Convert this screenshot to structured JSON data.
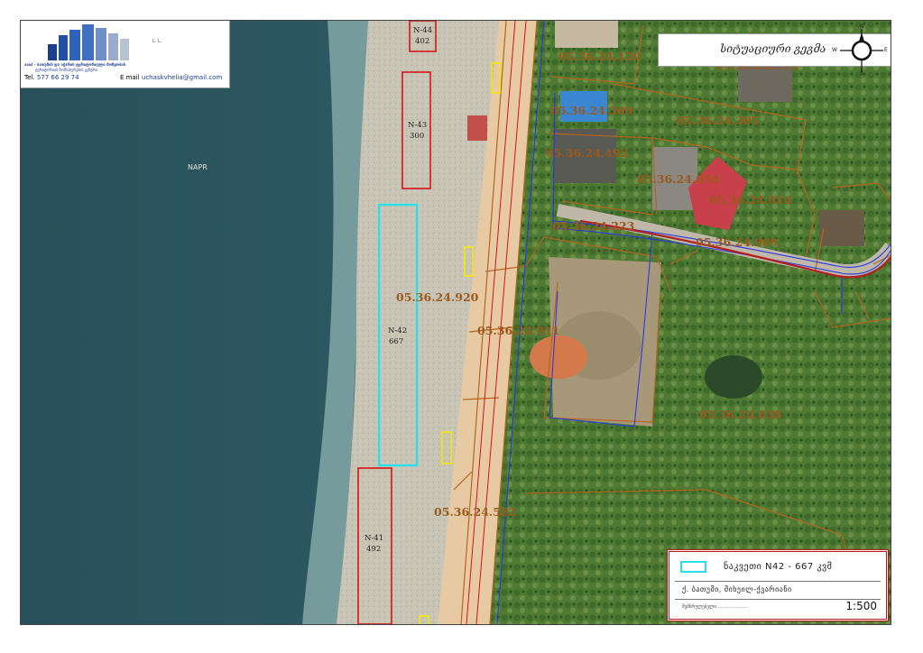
{
  "logo": {
    "mini_text": "L. L.",
    "company_line1": "ააიპ - ბათუმის და აჭარის ტერიტორიული მოწყობის",
    "company_line2": "ტერიტორიის მომსახურების ცენტრი",
    "tel_label": "Tel.",
    "tel_value": "577 66 29 74",
    "email_label": "E mail",
    "email_value": "uchaskvhelia@gmail.com"
  },
  "north_panel": {
    "title": "სიტუაციური გეგმა",
    "compass": {
      "n": "N",
      "s": "S",
      "e": "E",
      "w": "W"
    }
  },
  "map": {
    "sea_label": "NAPR",
    "parcels": [
      "05.36.24.120",
      "05.36.24.914",
      "05.36.24.509",
      "05.36.24.305",
      "05.36.24.492",
      "05.36.24.054",
      "05.36.24.014",
      "05.36.24.223",
      "05.36.24.909",
      "05.36.24.920",
      "05.36.24.911",
      "05.36.24.838",
      "05.36.24.582"
    ],
    "plots": [
      {
        "name": "N-44",
        "area": "402"
      },
      {
        "name": "N-43",
        "area": "300"
      },
      {
        "name": "N-42",
        "area": "667"
      },
      {
        "name": "N-41",
        "area": "492"
      }
    ]
  },
  "legend": {
    "item_text": "ნაკვეთი N42 - 667 კვმ",
    "region": "ქ. ბათუმი, მიხეილ-ქვარიანი",
    "small_text": "შემსრულებელი .....................",
    "scale": "1:500"
  },
  "colors": {
    "plot_outline": "#d41414",
    "highlight_outline": "#29e0ea",
    "parcel_outline": "#b5651d",
    "road_outline": "#2a3adf",
    "road_main": "#b02020",
    "small_marker": "#f2e21a"
  }
}
